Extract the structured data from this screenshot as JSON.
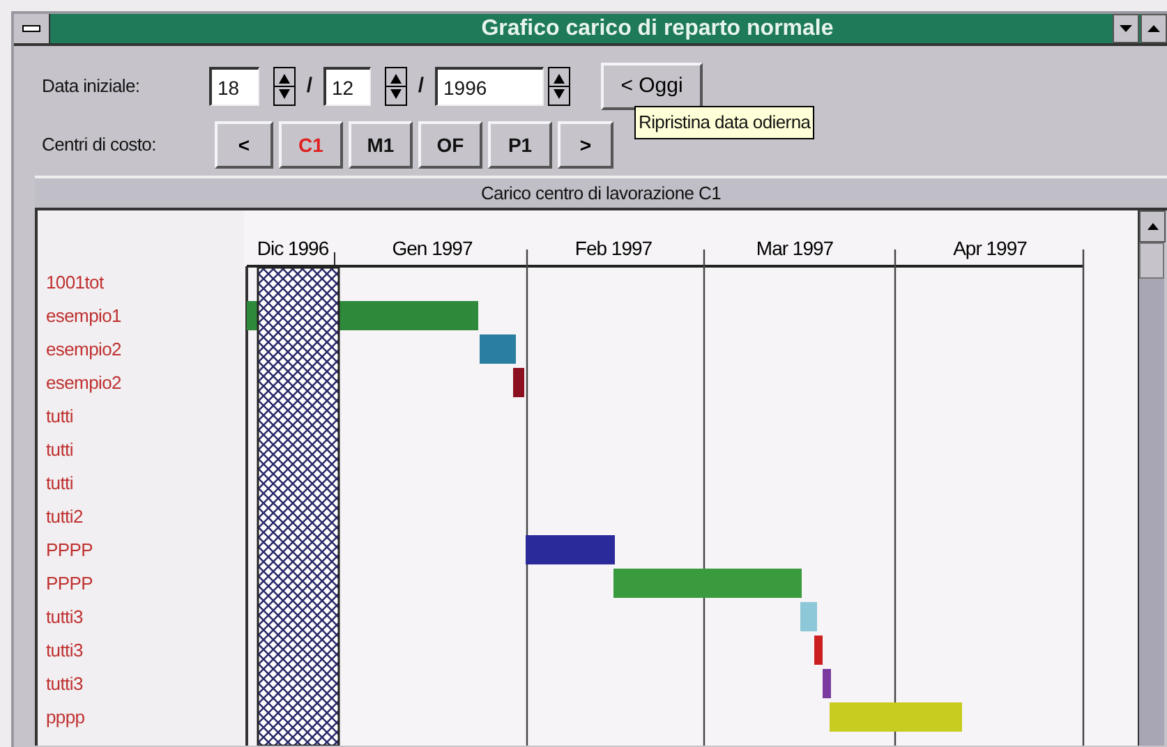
{
  "window": {
    "title": "Grafico carico di reparto normale"
  },
  "date": {
    "label": "Data iniziale:",
    "day": "18",
    "month": "12",
    "year": "1996",
    "separators": [
      "/",
      "/"
    ],
    "today_button": "< Oggi",
    "tooltip": "Ripristina data odierna"
  },
  "cost_centers": {
    "label": "Centri di costo:",
    "prev": "<",
    "next": ">",
    "items": [
      {
        "label": "C1",
        "selected": true
      },
      {
        "label": "M1",
        "selected": false
      },
      {
        "label": "OF",
        "selected": false
      },
      {
        "label": "P1",
        "selected": false
      }
    ]
  },
  "chart": {
    "title": "Carico centro di lavorazione C1",
    "months": [
      "Dic 1996",
      "Gen 1997",
      "Feb 1997",
      "Mar 1997",
      "Apr 1997"
    ],
    "rows": [
      "1001tot",
      "esempio1",
      "esempio2",
      "esempio2",
      "tutti",
      "tutti",
      "tutti",
      "tutti2",
      "PPPP",
      "PPPP",
      "tutti3",
      "tutti3",
      "tutti3",
      "pppp"
    ]
  }
}
